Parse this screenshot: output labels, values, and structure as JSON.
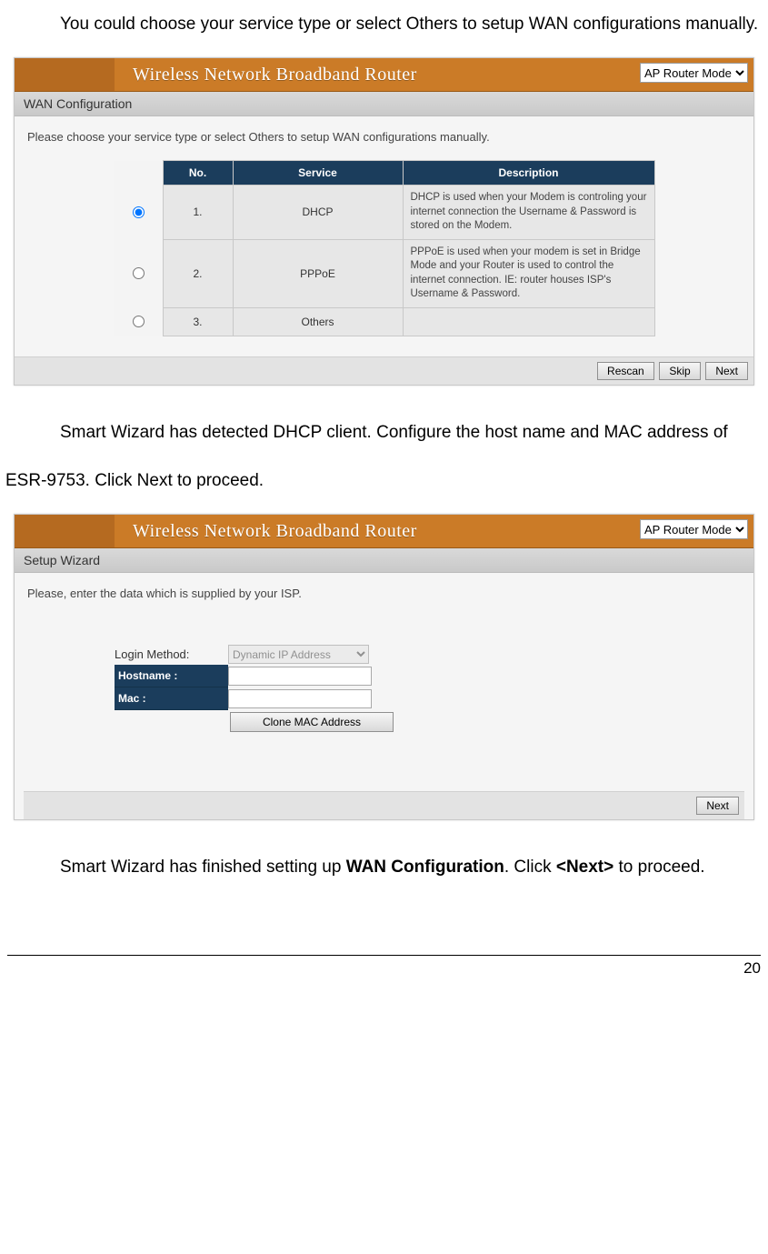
{
  "doc": {
    "para1": "You could choose your service type or select Others to setup WAN configurations manually.",
    "para2": "Smart Wizard has detected DHCP client. Configure the host name and MAC address of ESR-9753. Click Next to proceed.",
    "para3_a": "Smart Wizard has finished setting up ",
    "para3_b": "WAN Configuration",
    "para3_c": ". Click ",
    "para3_d": "<Next>",
    "para3_e": " to proceed.",
    "page_no": "20"
  },
  "router": {
    "title": "Wireless Network Broadband Router",
    "mode": "AP Router Mode"
  },
  "wan": {
    "subheader": "WAN Configuration",
    "instruction": "Please choose your service type or select Others to setup WAN configurations manually.",
    "th_no": "No.",
    "th_service": "Service",
    "th_desc": "Description",
    "rows": [
      {
        "no": "1.",
        "service": "DHCP",
        "desc": "DHCP is used when your Modem is controling your internet connection the Username & Password is stored on the Modem.",
        "checked": true
      },
      {
        "no": "2.",
        "service": "PPPoE",
        "desc": "PPPoE is used when your modem is set in Bridge Mode and your Router is used to control the internet connection. IE: router houses ISP's Username & Password.",
        "checked": false
      },
      {
        "no": "3.",
        "service": "Others",
        "desc": "",
        "checked": false
      }
    ],
    "btn_rescan": "Rescan",
    "btn_skip": "Skip",
    "btn_next": "Next"
  },
  "setup": {
    "subheader": "Setup Wizard",
    "instruction": "Please, enter the data which is supplied by your ISP.",
    "label_login": "Login Method:",
    "login_value": "Dynamic IP Address",
    "label_hostname": "Hostname :",
    "hostname_value": "",
    "label_mac": "Mac :",
    "mac_value": "",
    "btn_clone": "Clone MAC Address",
    "btn_next": "Next"
  }
}
